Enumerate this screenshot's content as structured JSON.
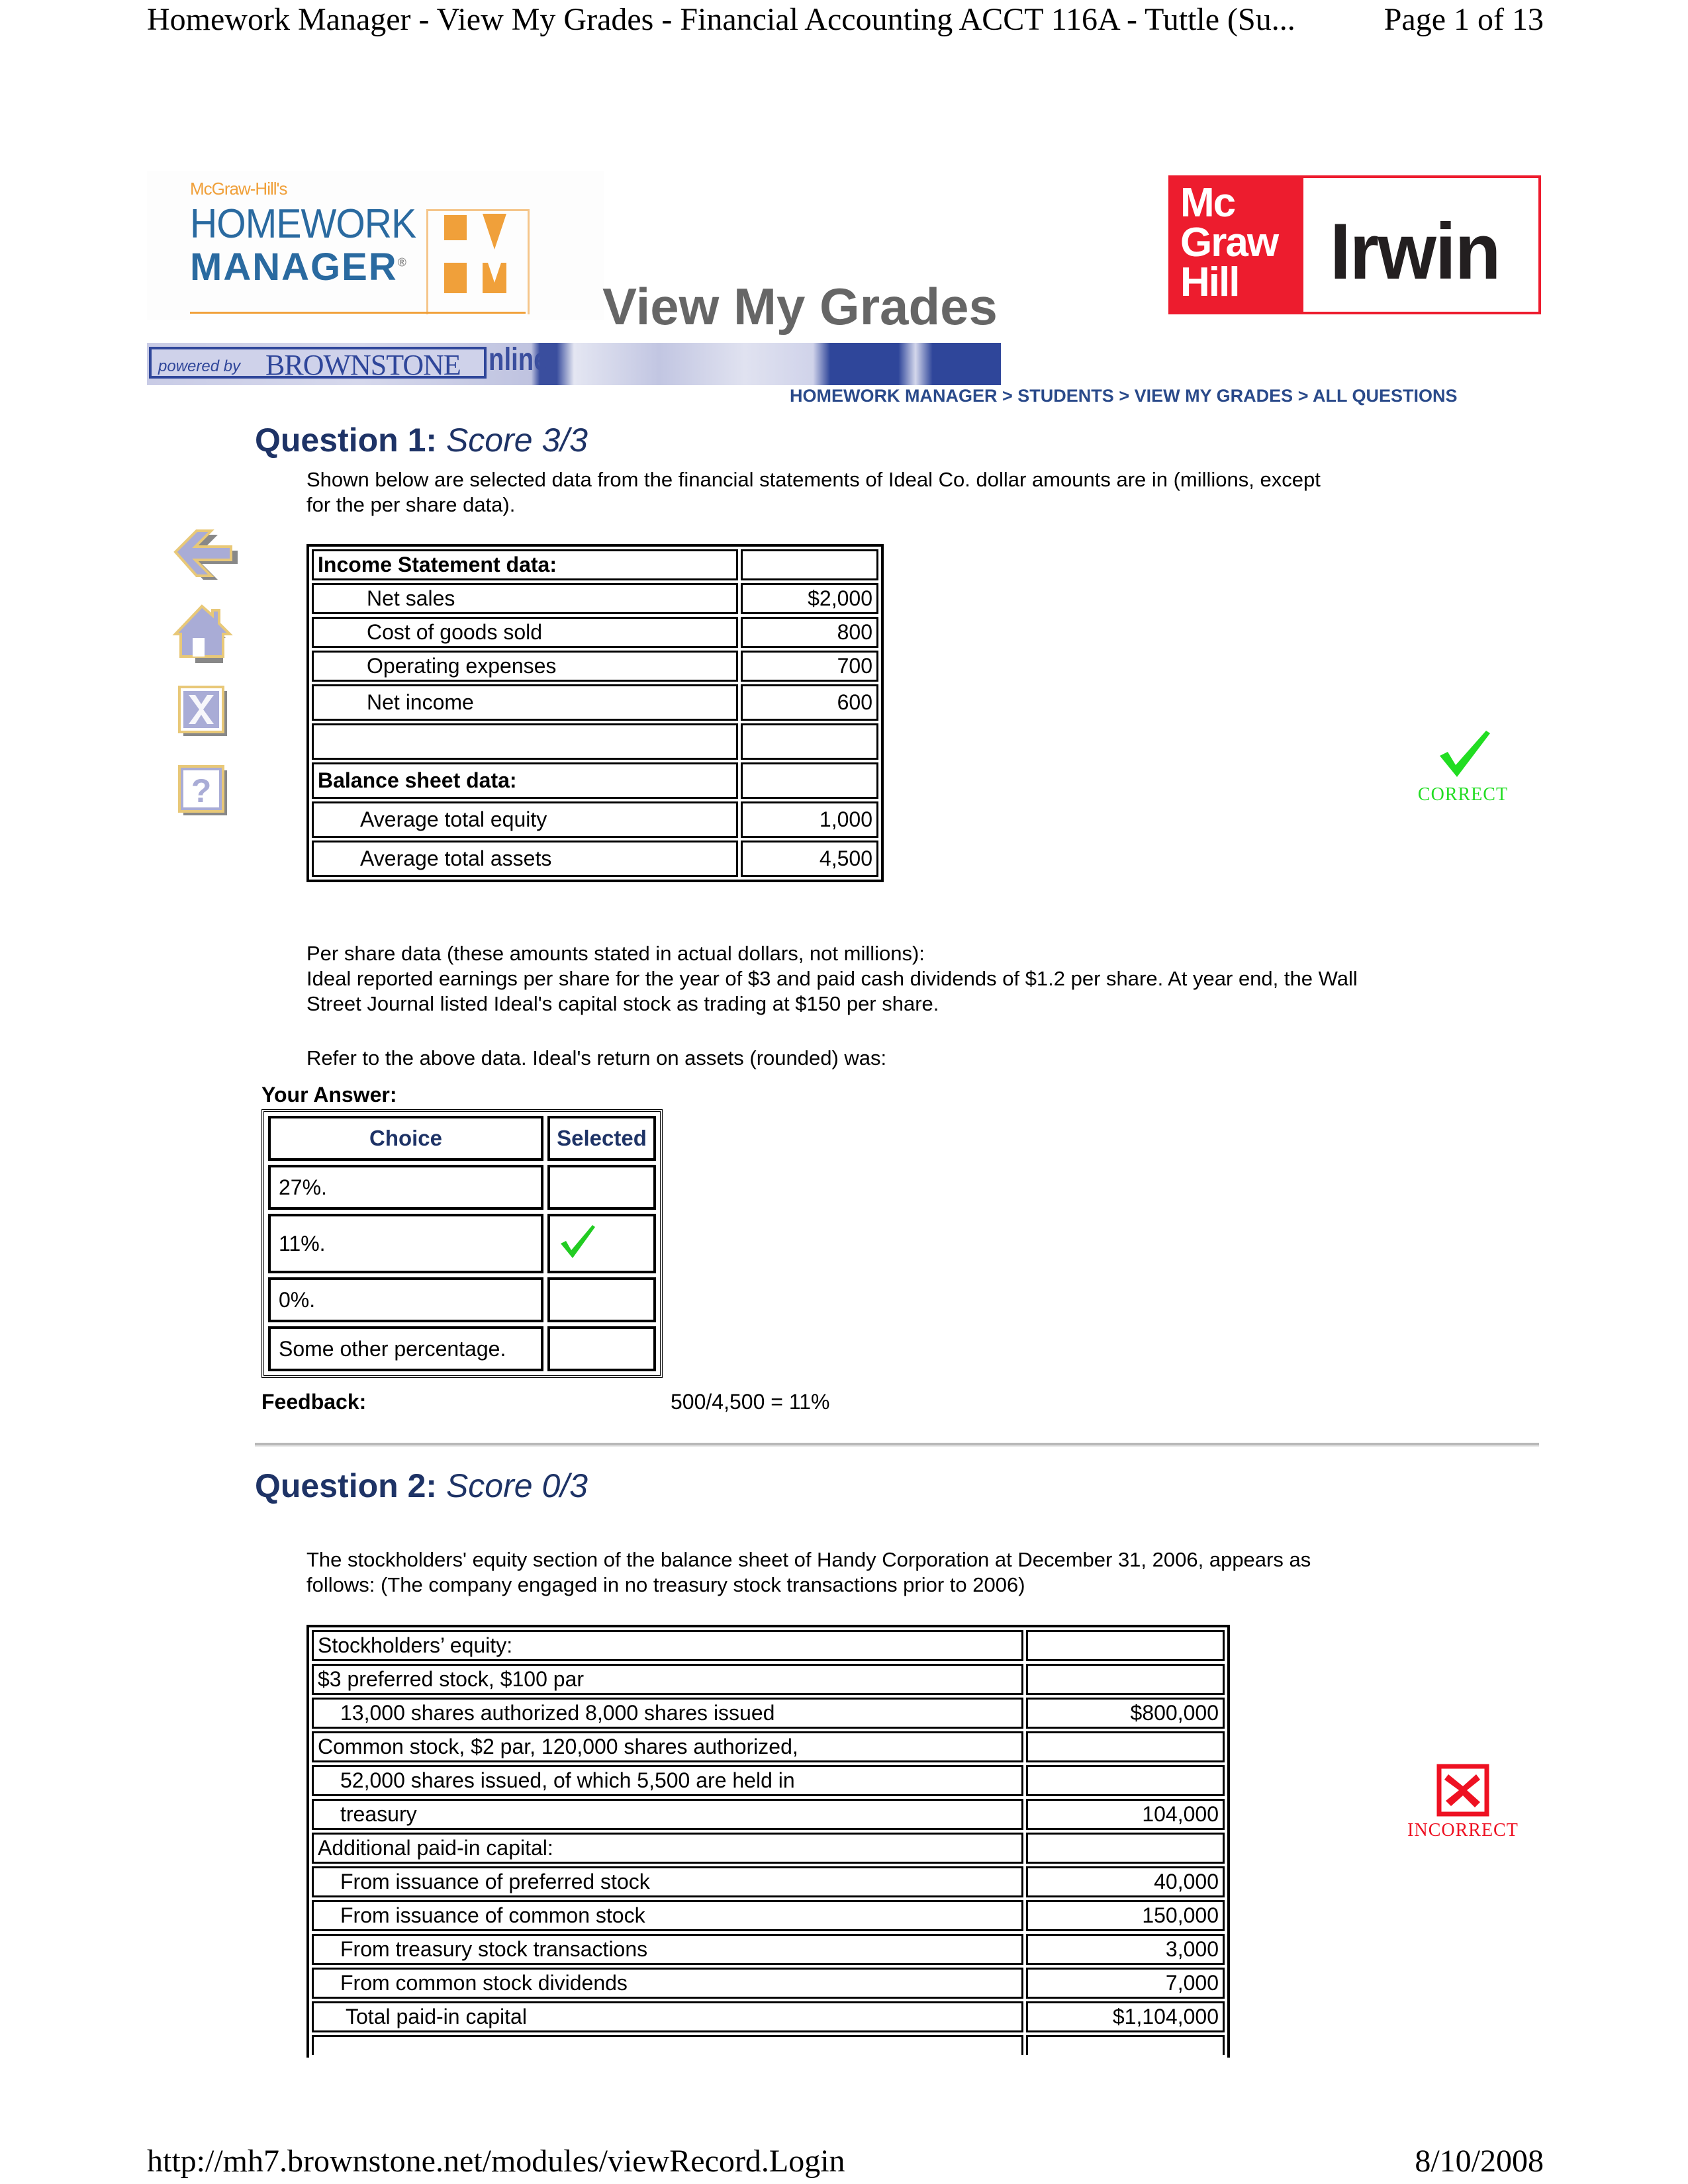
{
  "print_header": {
    "title": "Homework Manager - View My Grades - Financial Accounting ACCT 116A - Tuttle (Su...",
    "page": "Page 1 of 13"
  },
  "print_footer": {
    "url": "http://mh7.brownstone.net/modules/viewRecord.Login",
    "date": "8/10/2008"
  },
  "branding": {
    "hm_prefix": "McGraw-Hill's",
    "hm_line1": "HOMEWORK",
    "hm_line2": "MANAGER",
    "hm_reg": "®",
    "publisher_stack": [
      "Mc",
      "Graw",
      "Hill"
    ],
    "publisher_imprint": "Irwin",
    "powered_by": "powered by",
    "powered_by_brand": "BROWNSTONE",
    "online_fragment": "nline",
    "colors": {
      "hm_blue": "#2a6aa0",
      "hm_orange": "#f0a03a",
      "mgh_red": "#ed1c2e",
      "brownstone_blue": "#2f469a"
    }
  },
  "page_title": "View My Grades",
  "breadcrumb": {
    "items": [
      "HOMEWORK MANAGER",
      "STUDENTS",
      "VIEW MY GRADES",
      "ALL QUESTIONS"
    ],
    "separator": ">"
  },
  "side_nav": [
    {
      "icon": "back-arrow-icon",
      "label": "Back"
    },
    {
      "icon": "home-icon",
      "label": "Home"
    },
    {
      "icon": "close-icon",
      "label": "Close"
    },
    {
      "icon": "help-icon",
      "label": "Help"
    }
  ],
  "questions": [
    {
      "heading": "Question 1:",
      "score": "Score 3/3",
      "intro": "Shown below are selected data from the financial statements of Ideal Co. dollar amounts are in (millions, except for the per share data).",
      "table": [
        {
          "label": "Income Statement data:",
          "value": "",
          "style": "header"
        },
        {
          "label": "Net sales",
          "value": "$2,000",
          "style": "indent"
        },
        {
          "label": "Cost of goods sold",
          "value": "800",
          "style": "indent"
        },
        {
          "label": "Operating expenses",
          "value": "700",
          "style": "indent"
        },
        {
          "label": "Net income",
          "value": "600",
          "style": "indent"
        },
        {
          "label": "",
          "value": "",
          "style": "blank"
        },
        {
          "label": "Balance sheet data:",
          "value": "",
          "style": "header"
        },
        {
          "label": "Average total equity",
          "value": "1,000",
          "style": "indent2"
        },
        {
          "label": "Average total assets",
          "value": "4,500",
          "style": "indent2"
        }
      ],
      "per_share_heading": "Per share data (these amounts stated in actual dollars, not millions):",
      "per_share_text": "Ideal reported earnings per share for the year of $3 and paid cash dividends of $1.2 per share. At year end, the Wall Street Journal listed Ideal's capital stock as trading at $150 per share.",
      "prompt": "Refer to the above data. Ideal's return on assets (rounded) was:",
      "your_answer_label": "Your Answer:",
      "choice_header": "Choice",
      "selected_header": "Selected",
      "choices": [
        {
          "text": "27%.",
          "selected": false
        },
        {
          "text": "11%.",
          "selected": true
        },
        {
          "text": "0%.",
          "selected": false
        },
        {
          "text": "Some other percentage.",
          "selected": false
        }
      ],
      "feedback_label": "Feedback:",
      "feedback": "500/4,500 = 11%",
      "result": "CORRECT",
      "result_color": "#22dd22"
    },
    {
      "heading": "Question 2:",
      "score": "Score 0/3",
      "intro": "The stockholders' equity section of the balance sheet of Handy Corporation at December 31, 2006, appears as follows: (The company engaged in no treasury stock transactions prior to 2006)",
      "table": [
        {
          "label": "Stockholders’ equity:",
          "value": "",
          "style": "plain"
        },
        {
          "label": "$3 preferred stock, $100 par",
          "value": "",
          "style": "plain"
        },
        {
          "label": "13,000 shares authorized 8,000 shares issued",
          "value": "$800,000",
          "style": "indent3"
        },
        {
          "label": "Common stock, $2 par, 120,000 shares authorized,",
          "value": "",
          "style": "plain"
        },
        {
          "label": "52,000 shares issued, of which 5,500 are held in",
          "value": "",
          "style": "indent3"
        },
        {
          "label": "treasury",
          "value": "104,000",
          "style": "indent3"
        },
        {
          "label": "Additional paid-in capital:",
          "value": "",
          "style": "plain"
        },
        {
          "label": "From issuance of preferred stock",
          "value": "40,000",
          "style": "indent3"
        },
        {
          "label": "From issuance of common stock",
          "value": "150,000",
          "style": "indent3"
        },
        {
          "label": "From treasury stock transactions",
          "value": "3,000",
          "style": "indent3"
        },
        {
          "label": "From common stock dividends",
          "value": "7,000",
          "style": "indent3"
        },
        {
          "label": "Total paid-in capital",
          "value": "$1,104,000",
          "style": "indent3b"
        }
      ],
      "result": "INCORRECT",
      "result_color": "#ee1122"
    }
  ]
}
